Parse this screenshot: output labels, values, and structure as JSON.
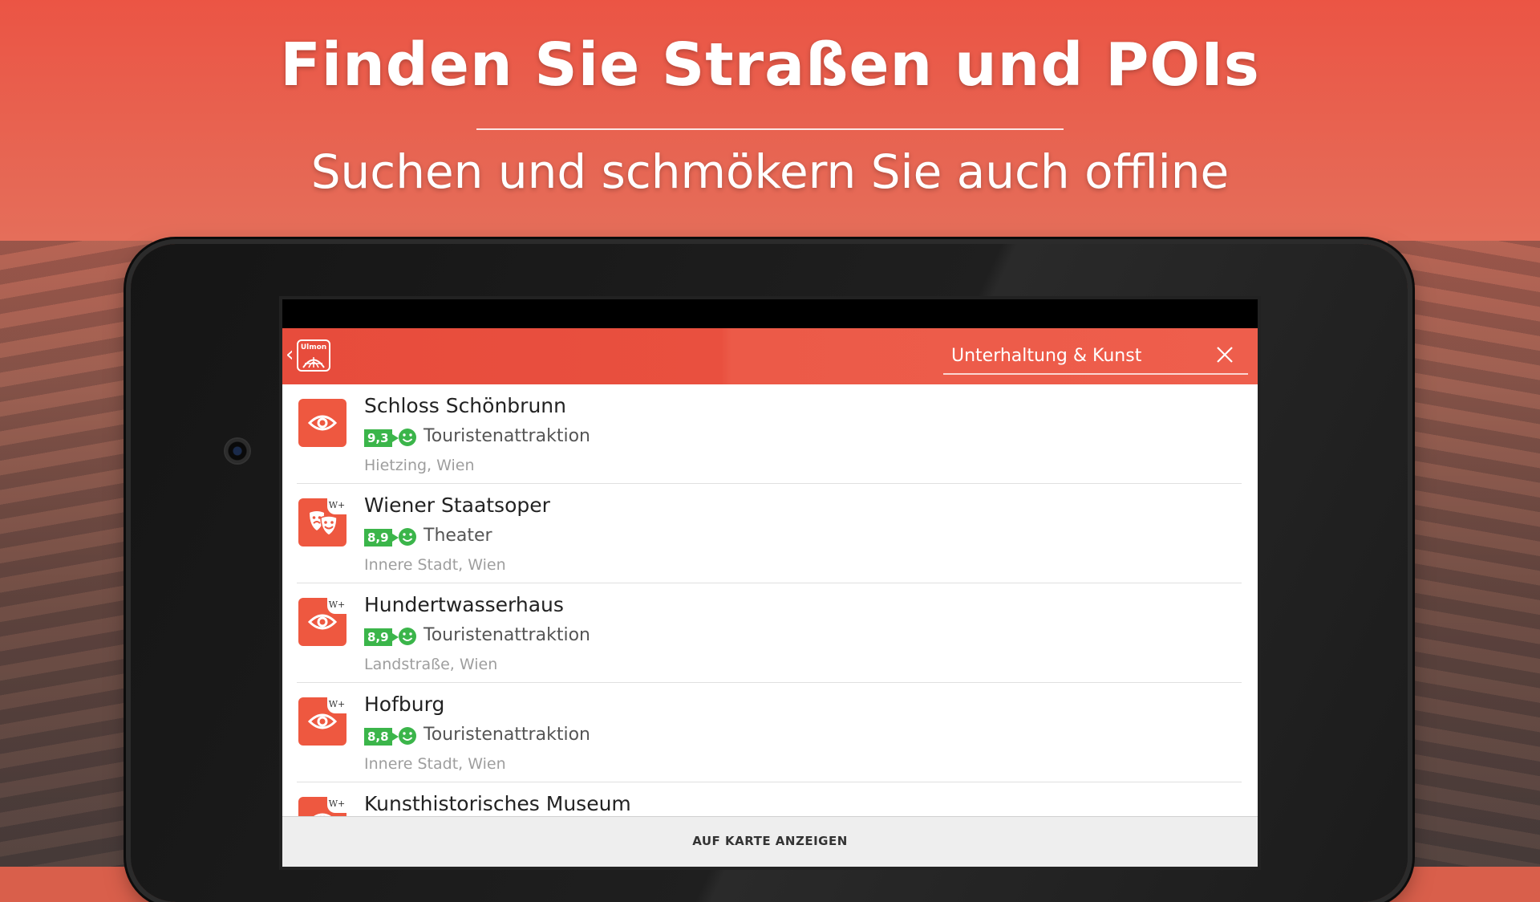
{
  "promo": {
    "headline": "Finden Sie Straßen und POIs",
    "subline": "Suchen und schmökern Sie auch offline"
  },
  "app": {
    "logo_text": "Ulmon",
    "search": {
      "value": "Unterhaltung & Kunst"
    },
    "colors": {
      "accent": "#e74c3c",
      "rating_green": "#3bb54a"
    }
  },
  "pois": [
    {
      "name": "Schloss Schönbrunn",
      "rating": "9,3",
      "type": "Touristenattraktion",
      "location": "Hietzing, Wien",
      "icon": "eye-icon",
      "wiki": ""
    },
    {
      "name": "Wiener Staatsoper",
      "rating": "8,9",
      "type": "Theater",
      "location": "Innere Stadt, Wien",
      "icon": "theater-masks-icon",
      "wiki": "W+"
    },
    {
      "name": "Hundertwasserhaus",
      "rating": "8,9",
      "type": "Touristenattraktion",
      "location": "Landstraße, Wien",
      "icon": "eye-icon",
      "wiki": "W+"
    },
    {
      "name": "Hofburg",
      "rating": "8,8",
      "type": "Touristenattraktion",
      "location": "Innere Stadt, Wien",
      "icon": "eye-icon",
      "wiki": "W+"
    },
    {
      "name": "Kunsthistorisches Museum",
      "rating": "",
      "type": "",
      "location": "",
      "icon": "eye-icon",
      "wiki": "W+"
    }
  ],
  "bottom": {
    "button_label": "AUF KARTE ANZEIGEN"
  }
}
